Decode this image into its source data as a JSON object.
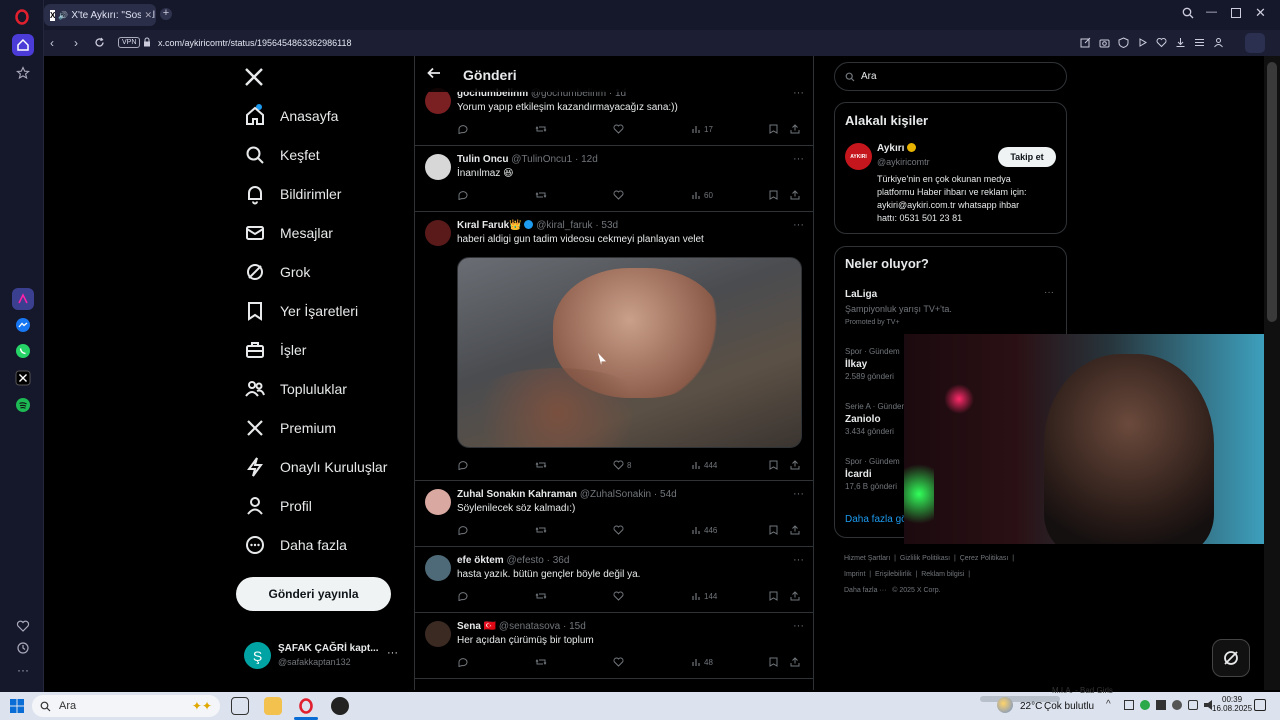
{
  "browser": {
    "tab_title": "X'te Aykırı: \"Sosyal me",
    "url": "x.com/aykiricomtr/status/1956454863362986118",
    "vpn_label": "VPN"
  },
  "nav": {
    "items": [
      {
        "label": "Anasayfa",
        "icon": "home-icon"
      },
      {
        "label": "Keşfet",
        "icon": "search-icon"
      },
      {
        "label": "Bildirimler",
        "icon": "bell-icon"
      },
      {
        "label": "Mesajlar",
        "icon": "mail-icon"
      },
      {
        "label": "Grok",
        "icon": "grok-icon"
      },
      {
        "label": "Yer İşaretleri",
        "icon": "bookmark-icon"
      },
      {
        "label": "İşler",
        "icon": "briefcase-icon"
      },
      {
        "label": "Topluluklar",
        "icon": "people-icon"
      },
      {
        "label": "Premium",
        "icon": "x-logo-icon"
      },
      {
        "label": "Onaylı Kuruluşlar",
        "icon": "lightning-icon"
      },
      {
        "label": "Profil",
        "icon": "person-icon"
      },
      {
        "label": "Daha fazla",
        "icon": "more-circle-icon"
      }
    ],
    "post_button": "Gönderi yayınla",
    "account": {
      "name": "ŞAFAK ÇAĞRİ kapt...",
      "handle": "@safakkaptan132",
      "avatar_letter": "Ş"
    }
  },
  "main": {
    "title": "Gönderi",
    "tweets": [
      {
        "name": "gochumbelinm",
        "handle": "@gochumbelinm · 1d",
        "text": "Yorum yapıp etkileşim kazandırmayacağız sana:))",
        "likes": "",
        "views": "17"
      },
      {
        "name": "Tulin Oncu",
        "handle": "@TulinOncu1 · 12d",
        "text": "İnanılmaz 😆",
        "likes": "",
        "views": "60"
      },
      {
        "name": "Kıral Faruk👑",
        "handle": "@kiral_faruk · 53d",
        "text": "haberi aldigi gun tadim videosu cekmeyi planlayan velet",
        "likes": "8",
        "views": "444"
      },
      {
        "name": "Zuhal Sonakın Kahraman",
        "handle": "@ZuhalSonakin · 54d",
        "text": "Söylenilecek söz kalmadı:)",
        "likes": "",
        "views": "446"
      },
      {
        "name": "efe öktem",
        "handle": "@efesto · 36d",
        "text": "hasta yazık. bütün gençler böyle değil ya.",
        "likes": "",
        "views": "144"
      },
      {
        "name": "Sena 🇹🇷",
        "handle": "@senatasova · 15d",
        "text": "Her açıdan çürümüş bir toplum",
        "likes": "",
        "views": "48"
      }
    ]
  },
  "right": {
    "search_placeholder": "Ara",
    "relevant_title": "Alakalı kişiler",
    "person": {
      "name": "Aykırı",
      "handle": "@aykiricomtr",
      "logo_text": "AYKIRI",
      "follow": "Takip et",
      "bio": [
        "Türkiye'nin en çok okunan medya",
        "platformu Haber ihbarı ve reklam için:",
        "aykiri@aykiri.com.tr whatsapp ihbar",
        "hattı: 0531 501 23 81"
      ]
    },
    "whats_title": "Neler oluyor?",
    "promo": {
      "title": "LaLiga",
      "sub": "Şampiyonluk yarışı TV+'ta.",
      "promoted": "Promoted by TV+"
    },
    "trends": [
      {
        "cat": "Spor · Gündem",
        "name": "İlkay",
        "count": "2.589 gönderi"
      },
      {
        "cat": "Serie A · Gündem",
        "name": "Zaniolo",
        "count": "3.434 gönderi"
      },
      {
        "cat": "Spor · Gündem",
        "name": "İcardi",
        "count": "17,6 B gönderi"
      }
    ],
    "show_more": "Daha fazla gö",
    "footer_line1": [
      "Hizmet Şartları",
      "Gizlilik Politikası",
      "Çerez Politikası"
    ],
    "footer_line2": [
      "Imprint",
      "Erişilebilirlik",
      "Reklam bilgisi"
    ],
    "footer_more": "Daha fazla ···",
    "copyright": "© 2025 X Corp."
  },
  "taskbar": {
    "search": "Ara",
    "weather": "22°C",
    "weather_text": "Çok bulutlu",
    "time": "00:39",
    "date": "16.08.2025",
    "media_text": "M.I.A. - Bad Girls"
  },
  "colors": {
    "accent": "#1d9bf0",
    "opera_red": "#e0202e",
    "background": "#000000"
  }
}
